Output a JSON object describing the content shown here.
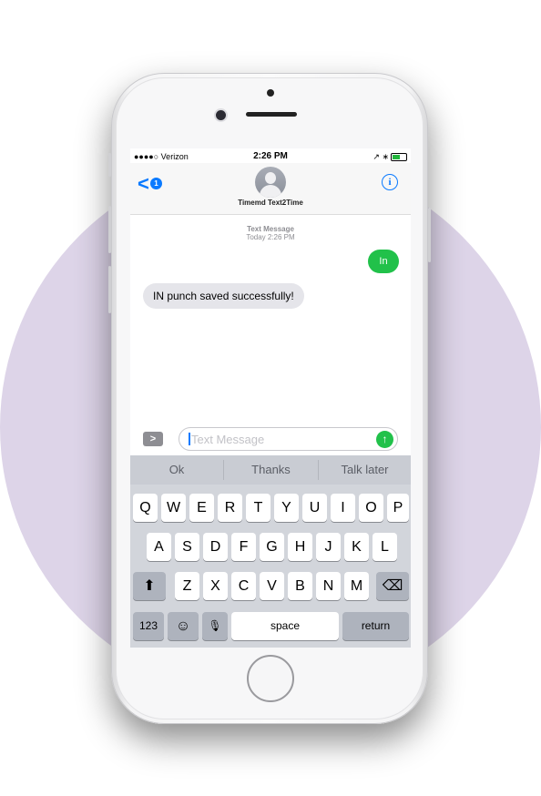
{
  "status_bar": {
    "carrier": "●●●●○ Verizon",
    "time": "2:26 PM",
    "right_icons": "↗ ∗"
  },
  "header": {
    "back_glyph": "<",
    "back_badge": "1",
    "contact_name": "Timemd Text2Time",
    "info_glyph": "i"
  },
  "thread": {
    "meta_title": "Text Message",
    "meta_time": "Today 2:26 PM",
    "outgoing": "In",
    "incoming": "IN punch saved successfully!"
  },
  "composer": {
    "expand_glyph": ">",
    "placeholder": "Text Message",
    "send_glyph": "↑"
  },
  "suggestions": [
    "Ok",
    "Thanks",
    "Talk later"
  ],
  "keyboard": {
    "row1": [
      "Q",
      "W",
      "E",
      "R",
      "T",
      "Y",
      "U",
      "I",
      "O",
      "P"
    ],
    "row2": [
      "A",
      "S",
      "D",
      "F",
      "G",
      "H",
      "J",
      "K",
      "L"
    ],
    "row3": [
      "Z",
      "X",
      "C",
      "V",
      "B",
      "N",
      "M"
    ],
    "shift_glyph": "⬆",
    "delete_glyph": "⌫",
    "numbers_label": "123",
    "emoji_glyph": "☺",
    "mic_glyph": "🎙",
    "space_label": "space",
    "return_label": "return"
  },
  "colors": {
    "accent": "#0a7aff",
    "sent_bubble": "#21c14a",
    "received_bubble": "#e5e5ea",
    "background_circle": "#ddd4e8"
  }
}
